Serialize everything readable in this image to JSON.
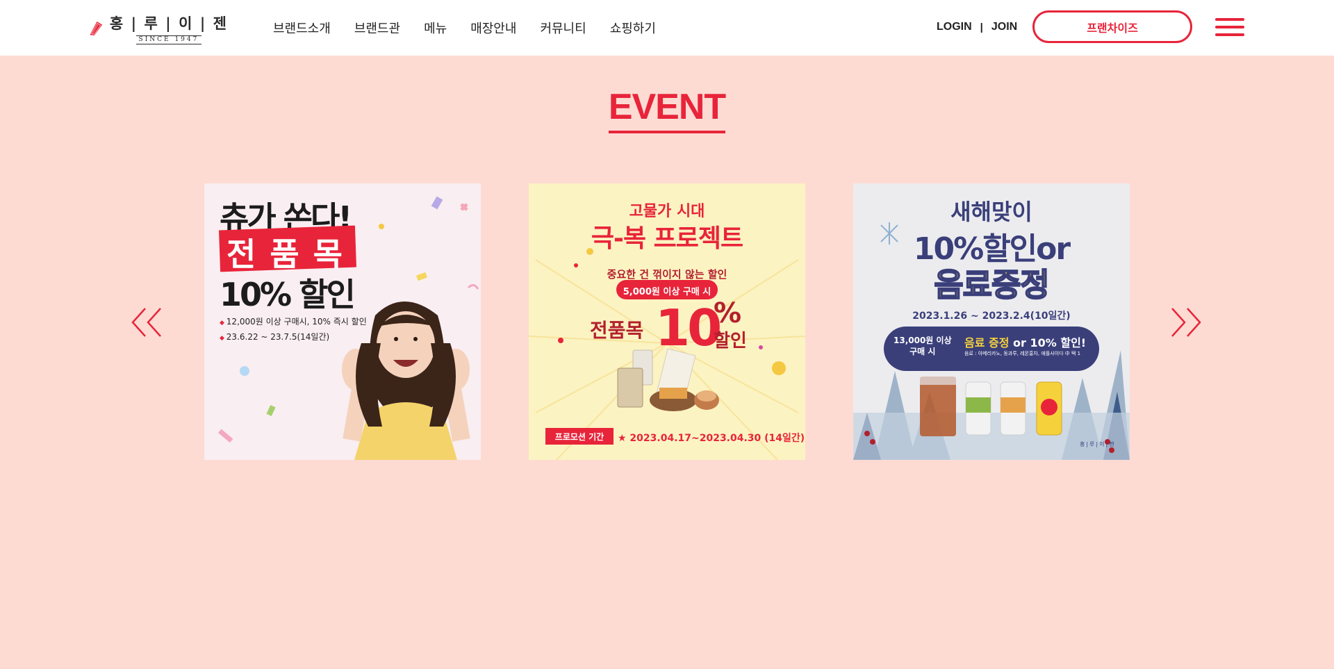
{
  "header": {
    "logo": {
      "name": "홍 | 루 | 이 | 젠",
      "since": "SINCE 1947"
    },
    "nav": [
      "브랜드소개",
      "브랜드관",
      "메뉴",
      "매장안내",
      "커뮤니티",
      "쇼핑하기"
    ],
    "login": "LOGIN",
    "separator": "|",
    "join": "JOIN",
    "franchise": "프랜차이즈",
    "colors": {
      "accent": "#e8243a",
      "background": "#fddbd3"
    }
  },
  "event": {
    "title": "EVENT",
    "cards": [
      {
        "headline": "츄가 쏜다!",
        "highlight": "전 품 목",
        "sale": "10% 할인",
        "details": [
          "12,000원 이상 구매시, 10% 즉시 할인",
          "23.6.22 ~ 23.7.5(14일간)"
        ]
      },
      {
        "era": "고물가 시대",
        "project": "극-복 프로젝트",
        "sub": "중요한 건 꺾이지 않는 할인",
        "condition": "5,000원 이상 구매 시",
        "all": "전품목",
        "number": "10",
        "percent": "%",
        "sale": "할인",
        "period_label": "프로모션 기간",
        "period": "★ 2023.04.17~2023.04.30 (14일간) ★"
      },
      {
        "headline": "새해맞이",
        "big1": "10%할인or",
        "big2": "음료증정",
        "dates": "2023.1.26 ~ 2023.2.4(10일간)",
        "condition": "13,000원 이상\n구매 시",
        "offer_hl": "음료 증정",
        "offer_rest": " or 10% 할인!",
        "note": "음료 : 아메리카노, 동과루, 레몬홍차, 애플사이다 中 택 1",
        "brand": "홍|루|이|젠"
      }
    ]
  }
}
